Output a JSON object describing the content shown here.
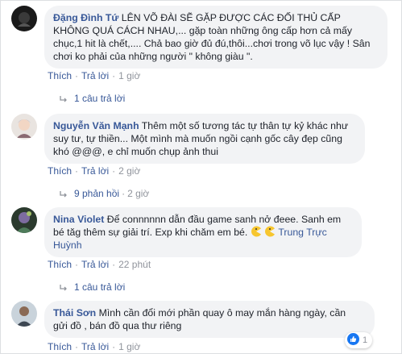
{
  "comments": [
    {
      "author": "Đặng Đình Tứ",
      "text_line1": " LÊN VÕ ĐÀI SẼ GẶP ĐƯỢC CÁC ĐỐI THỦ CẤP",
      "text_rest": "KHÔNG QUÁ CÁCH NHAU,... gặp toàn những ông cấp hơn cả mấy chục,1 hit là chết,.... Chả bao giờ đủ đú,thôi...chơi trong võ lục vậy ! Sân chơi ko phải của những người \" không giàu \".",
      "like": "Thích",
      "reply": "Trả lời",
      "time": "1 giờ",
      "replies": "1 câu trả lời",
      "replies_time": ""
    },
    {
      "author": "Nguyễn Văn Mạnh",
      "text_line1": " Thêm một số tương tác tự thân tự kỷ khác như",
      "text_rest": "suy tư, tự thiền... Một mình mà muốn ngồi cạnh gốc cây đẹp cũng khó @@@, e chỉ muốn chụp ảnh thui",
      "like": "Thích",
      "reply": "Trả lời",
      "time": "2 giờ",
      "replies": "9 phản hồi",
      "replies_time": "2 giờ"
    },
    {
      "author": "Nina Violet",
      "text_line1": " Để connnnnn dẫn đầu game sanh nở đeee. Sanh em",
      "text_rest": "bé tăg thêm sự giải trí. Exp khi chăm em bé.",
      "mention": "Trung Trực Huỳnh",
      "like": "Thích",
      "reply": "Trả lời",
      "time": "22 phút",
      "replies": "1 câu trả lời",
      "replies_time": ""
    },
    {
      "author": "Thái Sơn",
      "text_line1": " Mình cần đổi mới phần quay ô may mắn hàng ngày, cần",
      "text_rest": "gửi đồ , bán đồ qua thư riêng",
      "like": "Thích",
      "reply": "Trả lời",
      "time": "1 giờ",
      "reaction_count": "1"
    }
  ],
  "colors": {
    "link": "#385898",
    "meta": "#90949c",
    "bubble": "#f2f3f5",
    "like_badge": "#1877f2"
  }
}
